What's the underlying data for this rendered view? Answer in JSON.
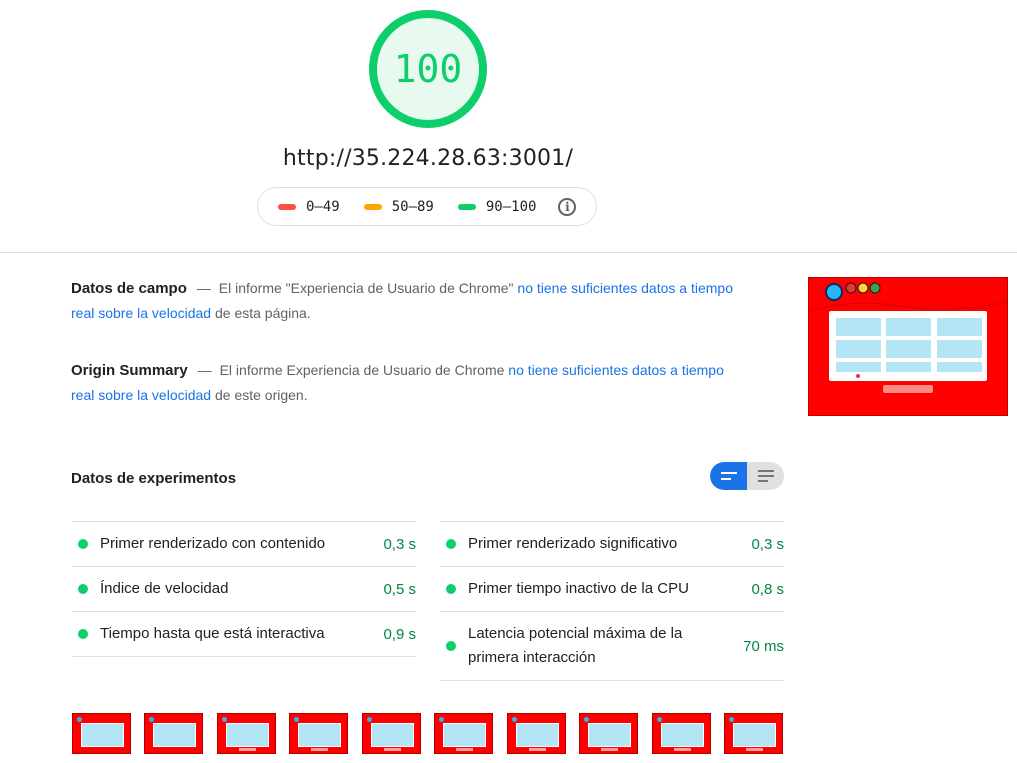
{
  "score": {
    "value": "100",
    "color": "#0cce6b",
    "fraction": 1.0
  },
  "url": "http://35.224.28.63:3001/",
  "legend": {
    "ranges": [
      {
        "label": "0–49",
        "color": "#ff4e42"
      },
      {
        "label": "50–89",
        "color": "#ffa400"
      },
      {
        "label": "90–100",
        "color": "#0cce6b"
      }
    ],
    "info_icon": "info-icon"
  },
  "field_data": {
    "heading": "Datos de campo",
    "dash": "—",
    "text_before": "El informe \"Experiencia de Usuario de Chrome\"",
    "link": "no tiene suficientes datos a tiempo real sobre la velocidad",
    "text_after": "de esta página."
  },
  "origin_summary": {
    "heading": "Origin Summary",
    "dash": "—",
    "text_before": "El informe Experiencia de Usuario de Chrome",
    "link": "no tiene suficientes datos a tiempo real sobre la velocidad",
    "text_after": "de este origen."
  },
  "lab_data": {
    "title": "Datos de experimentos",
    "toggle": {
      "left_icon": "compact-view-icon",
      "right_icon": "expanded-view-icon"
    },
    "left_metrics": [
      {
        "label": "Primer renderizado con contenido",
        "value": "0,3 s"
      },
      {
        "label": "Índice de velocidad",
        "value": "0,5 s"
      },
      {
        "label": "Tiempo hasta que está interactiva",
        "value": "0,9 s"
      }
    ],
    "right_metrics": [
      {
        "label": "Primer renderizado significativo",
        "value": "0,3 s"
      },
      {
        "label": "Primer tiempo inactivo de la CPU",
        "value": "0,8 s"
      },
      {
        "label": "Latencia potencial máxima de la primera interacción",
        "value": "70 ms"
      }
    ]
  },
  "colors": {
    "pass": "#0cce6b",
    "pass_text": "#018642",
    "link": "#1a73e8",
    "screenshot_bg": "#ff0000"
  }
}
